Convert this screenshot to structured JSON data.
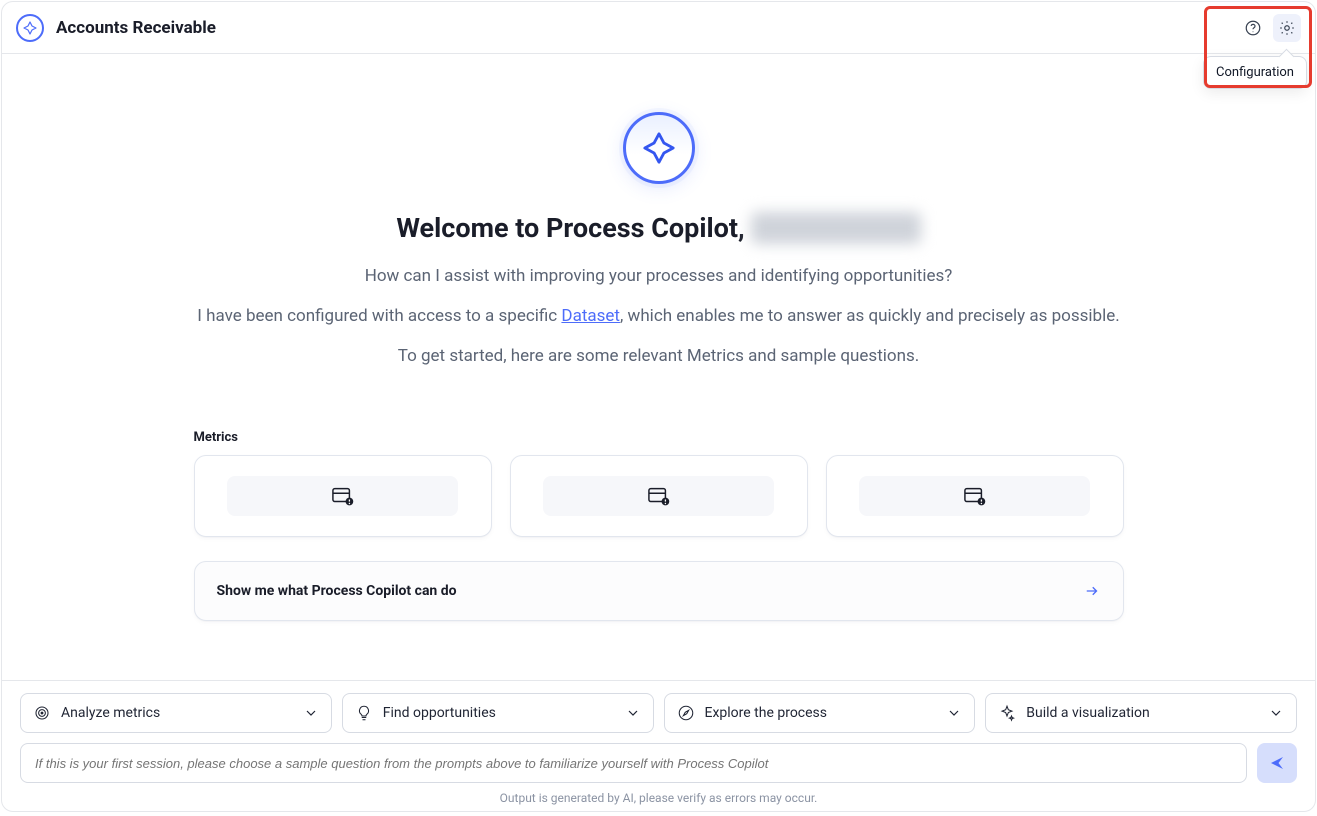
{
  "header": {
    "title": "Accounts Receivable",
    "tooltip": "Configuration"
  },
  "hero": {
    "welcome": "Welcome to Process Copilot,",
    "line1": "How can I assist with improving your processes and identifying opportunities?",
    "line2_a": "I have been configured with access to a specific ",
    "line2_link": "Dataset",
    "line2_b": ", which enables me to answer as quickly and precisely as possible.",
    "line3": "To get started, here are some relevant Metrics and sample questions."
  },
  "metrics": {
    "label": "Metrics"
  },
  "cta": {
    "showme": "Show me what Process Copilot can do"
  },
  "footer": {
    "pills": [
      {
        "label": "Analyze metrics"
      },
      {
        "label": "Find opportunities"
      },
      {
        "label": "Explore the process"
      },
      {
        "label": "Build a visualization"
      }
    ],
    "placeholder": "If this is your first session, please choose a sample question from the prompts above to familiarize yourself with Process Copilot",
    "disclaimer": "Output is generated by AI, please verify as errors may occur."
  }
}
